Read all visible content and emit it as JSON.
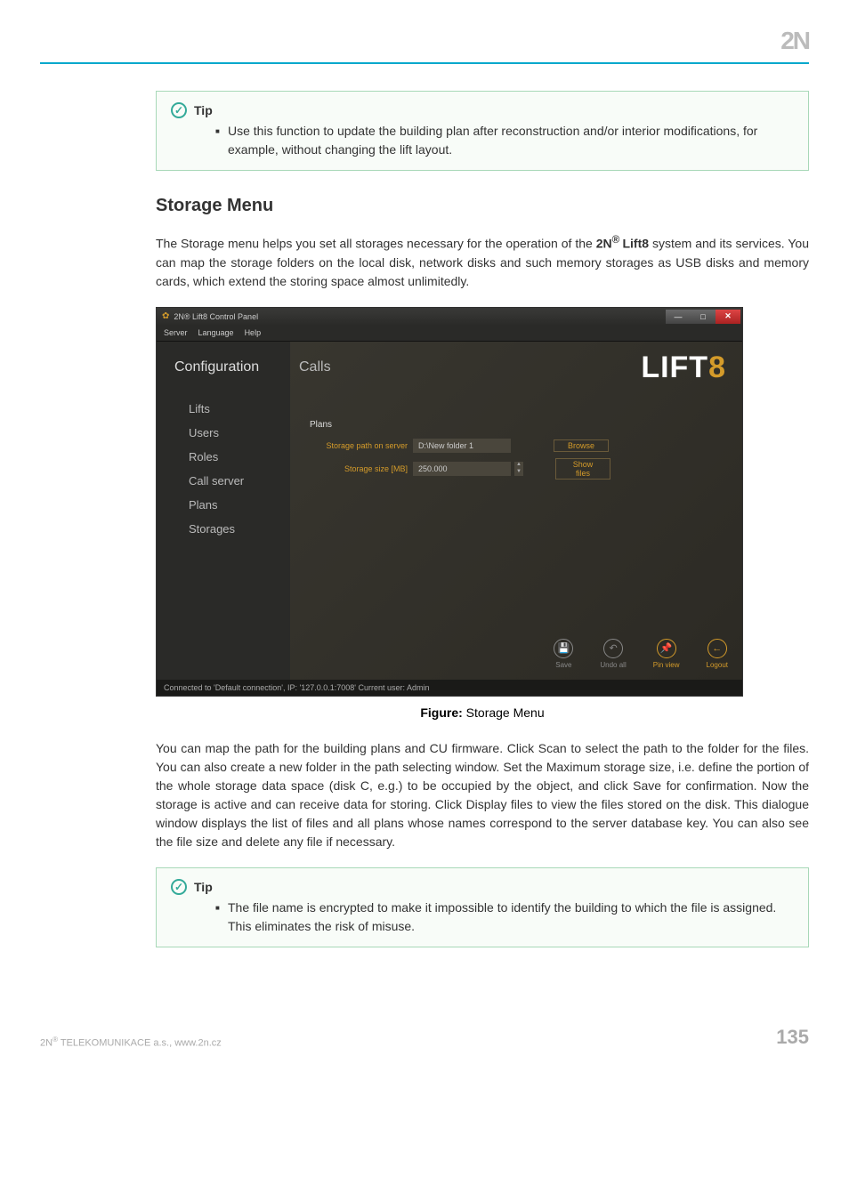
{
  "header": {
    "logo": "2N"
  },
  "tips": {
    "tip1": {
      "label": "Tip",
      "text": "Use this function to update the building plan after reconstruction and/or interior modifications, for example, without changing the lift layout."
    },
    "tip2": {
      "label": "Tip",
      "text": "The file name is encrypted to make it impossible to identify the building to which the file is assigned. This eliminates the risk of misuse."
    }
  },
  "section": {
    "title": "Storage Menu"
  },
  "intro": {
    "p1a": "The Storage menu helps you set all storages necessary for the operation of the ",
    "p1b": "2N",
    "p1c": "® ",
    "p1d": "Lift8",
    "p1e": " system and its services. You can map the storage folders on the local disk, network disks and such memory storages as USB disks and memory cards, which extend the storing space almost unlimitedly."
  },
  "app": {
    "title": "2N® Lift8 Control Panel",
    "menu": {
      "server": "Server",
      "language": "Language",
      "help": "Help"
    },
    "sidebar": {
      "title": "Configuration",
      "items": [
        "Lifts",
        "Users",
        "Roles",
        "Call server",
        "Plans",
        "Storages"
      ]
    },
    "breadcrumb": "Calls",
    "brand": "LIFT",
    "panel": {
      "label": "Plans",
      "row1": {
        "label": "Storage path on server",
        "value": "D:\\New folder 1",
        "btn": "Browse"
      },
      "row2": {
        "label": "Storage size [MB]",
        "value": "250.000",
        "btn": "Show files"
      }
    },
    "actions": {
      "save": "Save",
      "undo": "Undo all",
      "pin": "Pin view",
      "logout": "Logout"
    },
    "status": "Connected to 'Default connection', IP: '127.0.0.1:7008'  Current user: Admin"
  },
  "figure": {
    "label": "Figure:",
    "text": " Storage Menu"
  },
  "body2": "You can map the path for the building plans and CU firmware. Click Scan to select the path to the folder for the files. You can also create a new folder in the path selecting window. Set the Maximum storage size, i.e. define the portion of the whole storage data space (disk C, e.g.) to be occupied by the object, and click Save for confirmation. Now the storage is active and can receive data for storing. Click Display files to view the files stored on the disk. This dialogue window displays the list of files and all plans whose names correspond to the server database key. You can also see the file size and delete any file if necessary.",
  "footer": {
    "left_a": "2N",
    "left_b": " TELEKOMUNIKACE a.s., www.2n.cz",
    "page": "135"
  }
}
